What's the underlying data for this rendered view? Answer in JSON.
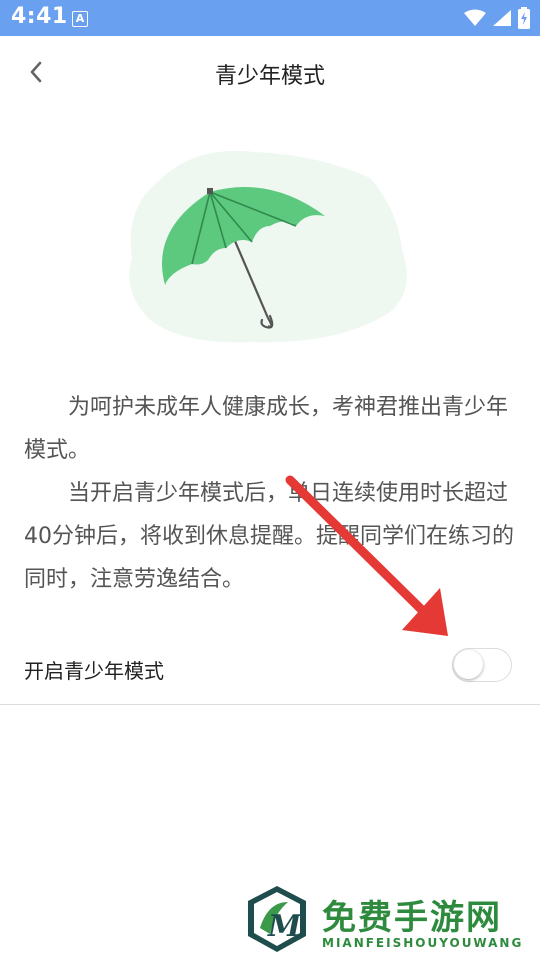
{
  "status_bar": {
    "time": "4:41",
    "app_icon_letter": "A",
    "icons": [
      "wifi-icon",
      "cell-signal-icon",
      "battery-charging-icon"
    ]
  },
  "app_bar": {
    "title": "青少年模式",
    "back_icon": "chevron-left-icon"
  },
  "illustration": {
    "icon": "umbrella-icon",
    "umbrella_color": "#5cc97f",
    "blob_color": "#eef8f0"
  },
  "description": {
    "paragraph_1": "为呵护未成年人健康成长，考神君推出青少年模式。",
    "paragraph_2": "当开启青少年模式后，单日连续使用时长超过40分钟后，将收到休息提醒。提醒同学们在练习的同时，注意劳逸结合。"
  },
  "annotation": {
    "arrow_color": "#e53935"
  },
  "setting": {
    "label": "开启青少年模式",
    "enabled": false
  },
  "watermark": {
    "title": "免费手游网",
    "subtitle": "MIANFEISHOUYOUWANG",
    "logo_letter": "M",
    "color": "#2e8b3e"
  },
  "colors": {
    "status_bar": "#6aa0f0",
    "title_text": "#222222",
    "body_text": "#555555",
    "divider": "#dcdcdc"
  }
}
